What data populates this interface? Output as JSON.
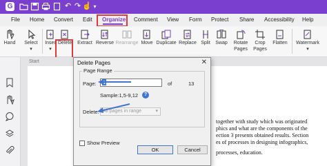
{
  "colors": {
    "accent": "#7a3fcf",
    "highlight": "#e23a3a",
    "arrow": "#3f74d3"
  },
  "menu": {
    "tabs": [
      {
        "label": "File"
      },
      {
        "label": "Home"
      },
      {
        "label": "Convert"
      },
      {
        "label": "Edit"
      },
      {
        "label": "Organize",
        "active": true
      },
      {
        "label": "Comment"
      },
      {
        "label": "View"
      },
      {
        "label": "Form"
      },
      {
        "label": "Protect"
      },
      {
        "label": "Share"
      },
      {
        "label": "Accessibility"
      },
      {
        "label": "Help"
      }
    ]
  },
  "ribbon": {
    "hand": "Hand",
    "select": "Select",
    "insert": "Inser",
    "delete": "Delete",
    "extract": "Extract",
    "reverse": "Reverse",
    "rearrange": "Rearrange",
    "move": "Move",
    "duplicate": "Duplicate",
    "replace": "Replace",
    "split": "Split",
    "swap": "Swap",
    "rotate_pages_1": "Rotate",
    "rotate_pages_2": "Pages",
    "crop_pages_1": "Crop",
    "crop_pages_2": "Pages",
    "flatten": "Flatten",
    "watermark": "Watermark"
  },
  "document": {
    "start_label": "Start",
    "lines": [
      "together with study which was originated",
      "phics and what are the components of the",
      "ection 3 presents obtained results. Section",
      "es of processes in designing infographics,",
      "processes, education."
    ]
  },
  "dialog": {
    "title": "Delete Pages",
    "close": "✕",
    "group_label": "Page Range",
    "page_label": "Page:",
    "page_value": "1",
    "of_label": "of",
    "total_pages": "13",
    "sample": "Sample:1,5-9,12",
    "delete_label": "Delete:",
    "delete_value": "All pages in range",
    "show_preview": "Show Preview",
    "ok": "OK",
    "cancel": "Cancel"
  }
}
